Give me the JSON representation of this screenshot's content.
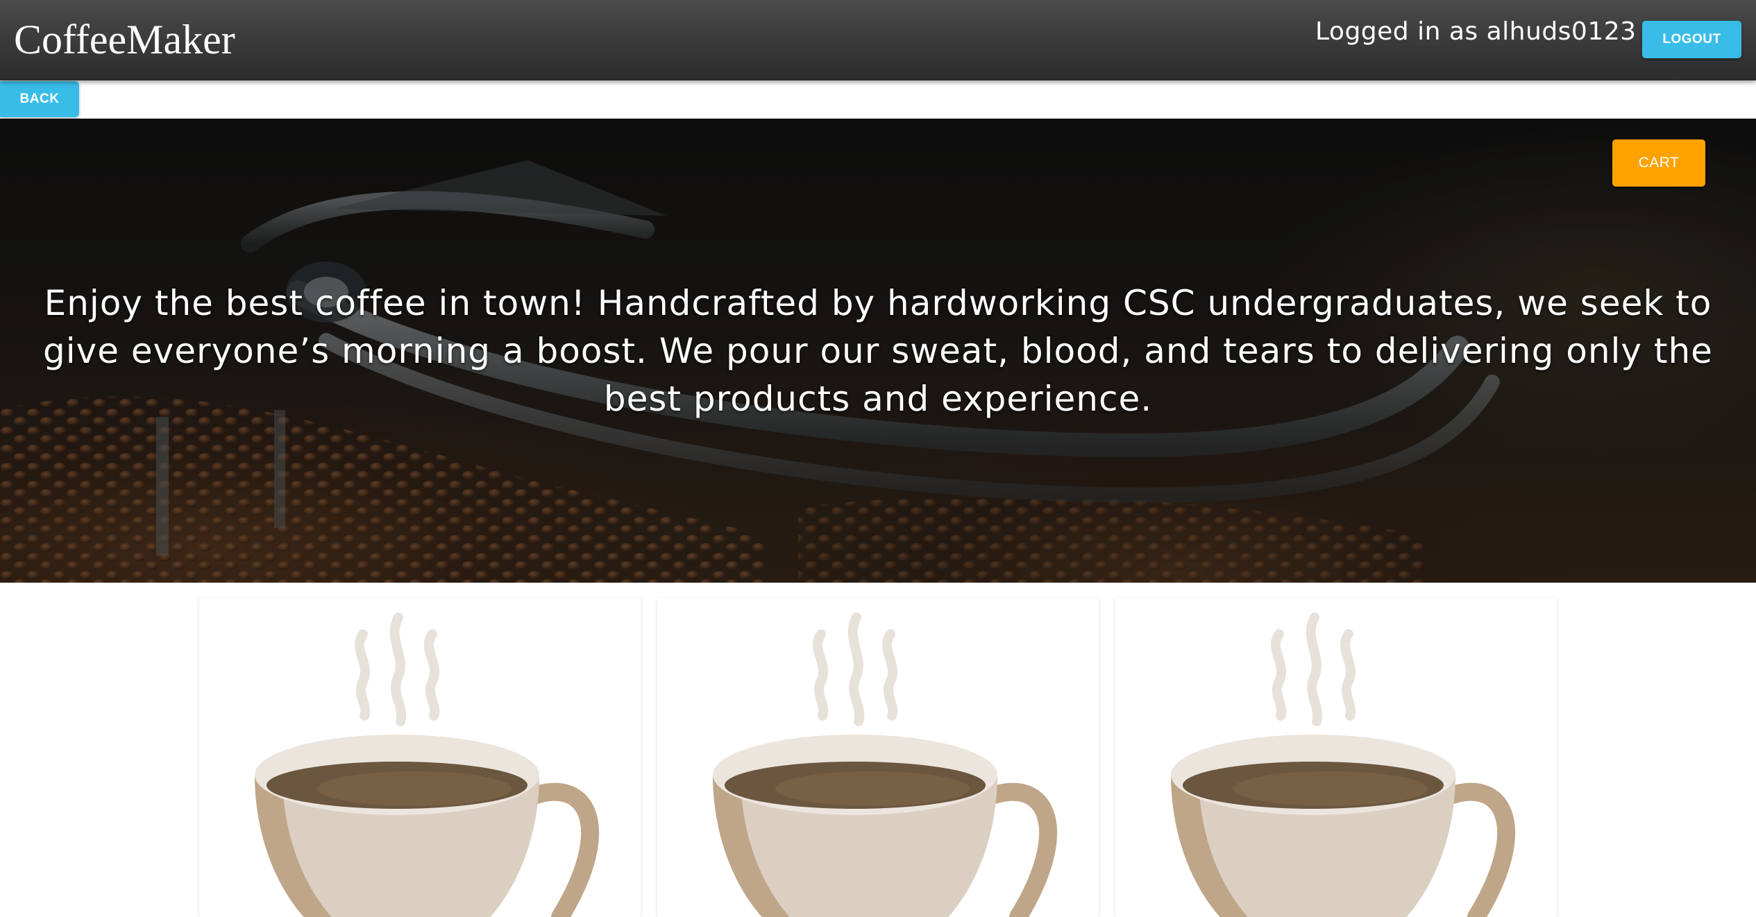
{
  "header": {
    "brand": "CoffeeMaker",
    "logged_in_text": "Logged in as alhuds0123",
    "logout_label": "LOGOUT"
  },
  "nav": {
    "back_label": "BACK"
  },
  "hero": {
    "cart_label": "CART",
    "tagline": "Enjoy the best coffee in town! Handcrafted by hardworking CSC undergraduates, we seek to give everyone’s morning a boost. We pour our sweat, blood, and tears to delivering only the best products and experience."
  },
  "products": {
    "cards": [
      {
        "image": "coffee-cup-icon"
      },
      {
        "image": "coffee-cup-icon"
      },
      {
        "image": "coffee-cup-icon"
      }
    ]
  },
  "colors": {
    "header_bg": "#333333",
    "accent_blue": "#39bde8",
    "cart_orange": "#ffa200",
    "cup_body": "#dbcfc2",
    "cup_shadow": "#bfa688",
    "coffee": "#6b563f",
    "steam": "#e8e1d9"
  }
}
